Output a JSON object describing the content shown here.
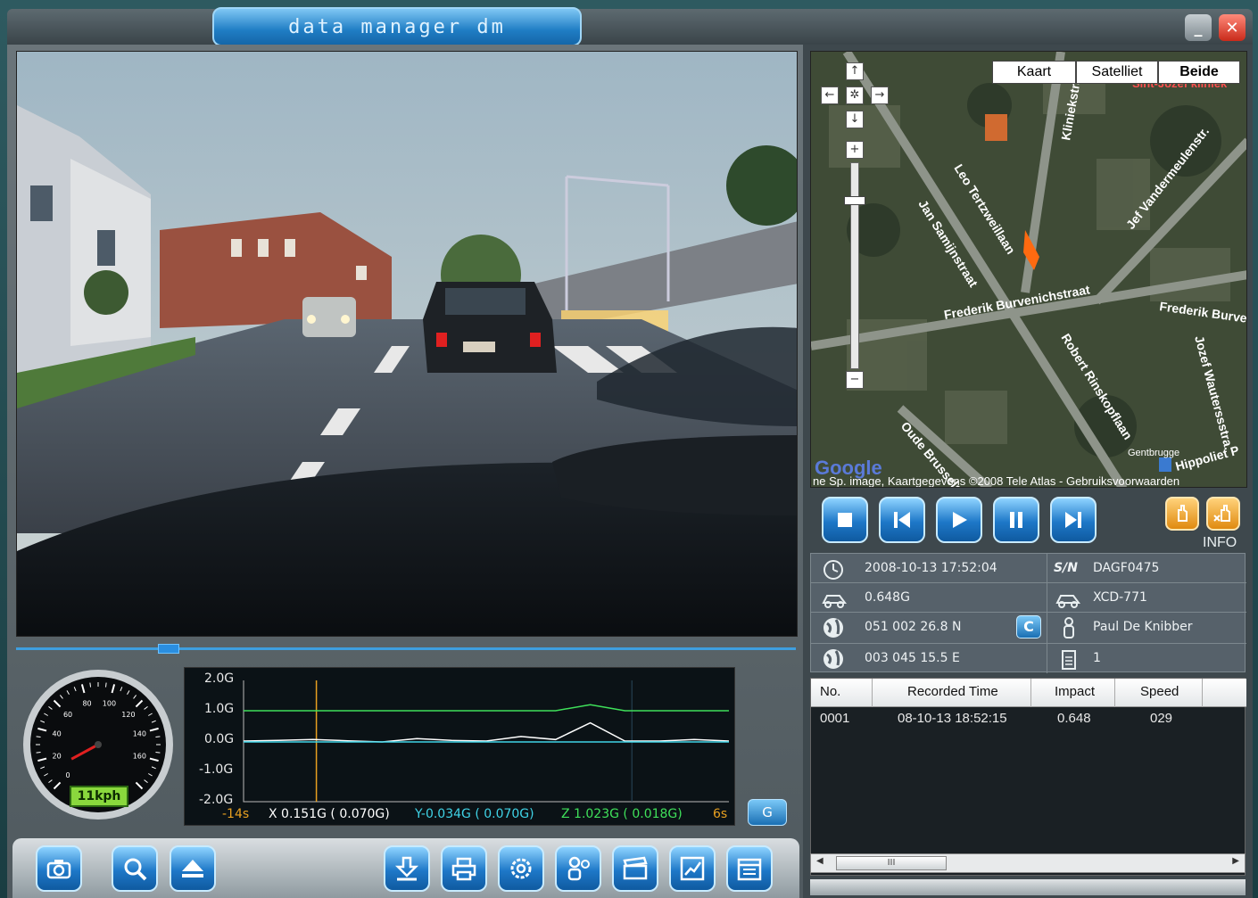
{
  "app": {
    "title": "data manager dm"
  },
  "window": {
    "minimize_label": "_",
    "close_label": "✕"
  },
  "speedometer": {
    "ticks": [
      "0",
      "20",
      "40",
      "60",
      "80",
      "100",
      "120",
      "140",
      "160"
    ],
    "readout": "11kph",
    "value_kph": 11
  },
  "gchart": {
    "y_ticks": [
      "2.0G",
      "1.0G",
      "0.0G",
      "-1.0G",
      "-2.0G"
    ],
    "x_start": "-14s",
    "x_end": "6s",
    "x_text": "X 0.151G ( 0.070G)",
    "y_text": "Y-0.034G ( 0.070G)",
    "z_text": "Z 1.023G ( 0.018G)",
    "button_label": "G",
    "colors": {
      "x": "#ffffff",
      "y": "#3fd3e6",
      "z": "#3fe05a",
      "marker": "#e8a020"
    }
  },
  "chart_data": {
    "type": "line",
    "x_range": [
      -14,
      6
    ],
    "ylim": [
      -2.0,
      2.0
    ],
    "series": [
      {
        "name": "X",
        "values": [
          0.0,
          0.02,
          0.05,
          0.01,
          -0.03,
          0.08,
          0.02,
          0.0,
          0.15,
          0.05,
          0.6,
          0.0,
          0.0,
          0.05,
          0.0
        ]
      },
      {
        "name": "Y",
        "values": [
          -0.03,
          -0.03,
          -0.03,
          -0.03,
          -0.03,
          -0.03,
          -0.03,
          -0.03,
          -0.03,
          -0.03,
          -0.03,
          -0.03,
          -0.03,
          -0.03,
          -0.03
        ]
      },
      {
        "name": "Z",
        "values": [
          1.0,
          1.0,
          1.0,
          1.0,
          1.0,
          1.0,
          1.0,
          1.0,
          1.0,
          1.0,
          1.2,
          1.0,
          1.0,
          1.0,
          1.0
        ]
      }
    ]
  },
  "map": {
    "types": [
      "Kaart",
      "Satelliet",
      "Beide"
    ],
    "active_type": "Beide",
    "streets": [
      "Kliniekstraat",
      "Leo Tertzweillaan",
      "Jan Samijnstraat",
      "Jef Vandermeulenstr.",
      "Frederik Burvenichstraat",
      "Frederik Burve",
      "Robert Rinskopflaan",
      "Jozef Wauterssstra.",
      "Oude Brusselse",
      "Hippoliet P",
      "Gentbrugge",
      "Sint-Jozef kliniek"
    ],
    "attribution": "ne Sp. image, Kaartgegevens ©2008 Tele Atlas - Gebruiksvoorwaarden",
    "logo": "Google"
  },
  "playback": {
    "info_label": "INFO"
  },
  "info": {
    "datetime": "2008-10-13  17:52:04",
    "sn_label": "S/N",
    "serial": "DAGF0475",
    "impact": "0.648G",
    "plate": "XCD-771",
    "latitude": "051 002 26.8 N",
    "gps_button": "C",
    "driver": "Paul De Knibber",
    "longitude": "003 045 15.5 E",
    "event_count": "1"
  },
  "table": {
    "headers": [
      "No.",
      "Recorded Time",
      "Impact",
      "Speed"
    ],
    "rows": [
      {
        "no": "0001",
        "time": "08-10-13  18:52:15",
        "impact": "0.648",
        "speed": "029"
      }
    ],
    "scroll_thumb": "III"
  },
  "toolbar": {
    "buttons": [
      "camera-icon",
      "zoom-icon",
      "eject-icon",
      "download-icon",
      "print-icon",
      "settings-icon",
      "users-icon",
      "clapper-icon",
      "graph-icon",
      "calendar-icon"
    ]
  }
}
